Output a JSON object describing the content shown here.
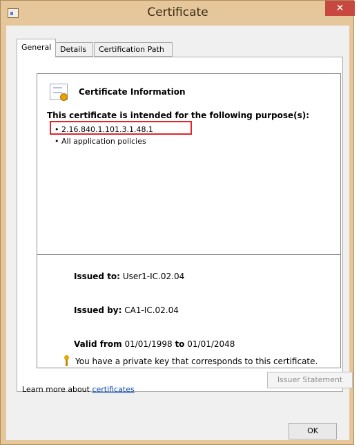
{
  "window": {
    "title": "Certificate",
    "close_label": "✕"
  },
  "tabs": [
    {
      "label": "General",
      "active": true
    },
    {
      "label": "Details",
      "active": false
    },
    {
      "label": "Certification Path",
      "active": false
    }
  ],
  "info": {
    "title": "Certificate Information",
    "purpose_heading": "This certificate is intended for the following purpose(s):",
    "purposes": [
      "• 2.16.840.1.101.3.1.48.1",
      "• All application policies"
    ],
    "issued_to_label": "Issued to:",
    "issued_to": "User1-IC.02.04",
    "issued_by_label": "Issued by:",
    "issued_by": "CA1-IC.02.04",
    "valid_from_label": "Valid from",
    "valid_from": "01/01/1998",
    "valid_to_label": "to",
    "valid_to": "01/01/2048",
    "private_key_note": "You have a private key that corresponds to this certificate."
  },
  "buttons": {
    "issuer_statement": "Issuer Statement",
    "ok": "OK"
  },
  "footer": {
    "learn_prefix": "Learn more about ",
    "learn_link": "certificates"
  },
  "colors": {
    "frame": "#e6c79b",
    "close": "#c7483f",
    "highlight": "#e0262c",
    "link": "#0645ad"
  }
}
